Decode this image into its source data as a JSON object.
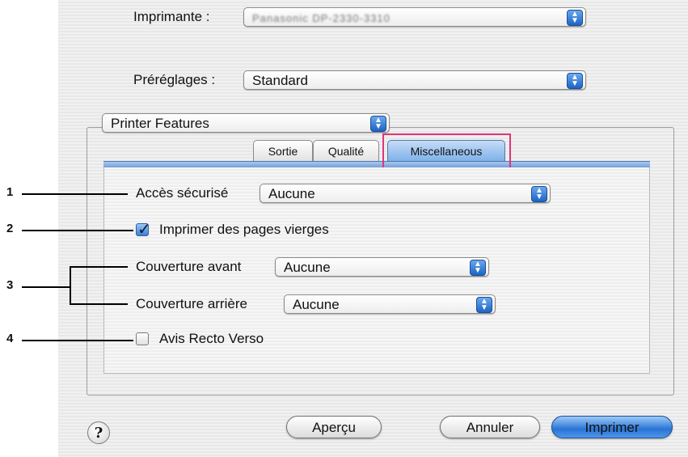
{
  "dialog": {
    "printer_label": "Imprimante :",
    "printer_value": "Panasonic DP-2330-3310",
    "presets_label": "Préréglages :",
    "presets_value": "Standard",
    "panel_select": "Printer Features"
  },
  "tabs": [
    {
      "label": "Sortie"
    },
    {
      "label": "Qualité"
    },
    {
      "label": "Miscellaneous",
      "active": true
    }
  ],
  "settings": {
    "secure_access_label": "Accès sécurisé",
    "secure_access_value": "Aucune",
    "print_blank_pages_label": "Imprimer des pages vierges",
    "print_blank_pages_checked": true,
    "front_cover_label": "Couverture avant",
    "front_cover_value": "Aucune",
    "back_cover_label": "Couverture arrière",
    "back_cover_value": "Aucune",
    "duplex_notice_label": "Avis Recto Verso",
    "duplex_notice_checked": false
  },
  "callouts": [
    "1",
    "2",
    "3",
    "4"
  ],
  "buttons": {
    "help": "?",
    "preview": "Aperçu",
    "cancel": "Annuler",
    "print": "Imprimer"
  },
  "colors": {
    "accent": "#2a74d5",
    "highlight_box": "#e0357a"
  }
}
